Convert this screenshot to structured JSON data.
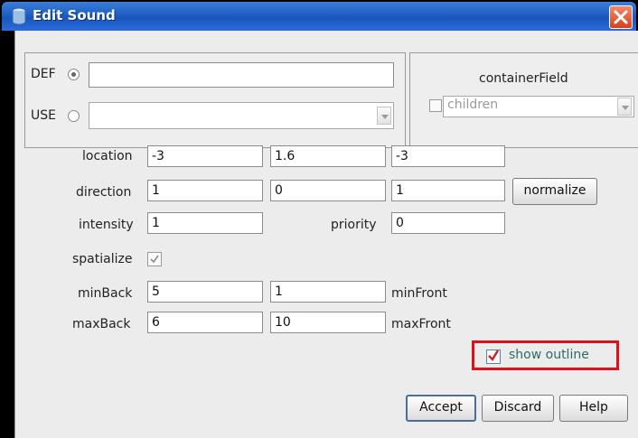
{
  "window": {
    "title": "Edit Sound"
  },
  "def_use": {
    "def_label": "DEF",
    "def_value": "",
    "use_label": "USE",
    "use_value": ""
  },
  "container_field": {
    "title": "containerField",
    "value": "children"
  },
  "fields": {
    "location_label": "location",
    "location": [
      "-3",
      "1.6",
      "-3"
    ],
    "direction_label": "direction",
    "direction": [
      "1",
      "0",
      "1"
    ],
    "normalize_label": "normalize",
    "intensity_label": "intensity",
    "intensity": "1",
    "priority_label": "priority",
    "priority": "0",
    "spatialize_label": "spatialize",
    "spatialize_checked": true,
    "minBack_label": "minBack",
    "minBack": "5",
    "minFront": "1",
    "minFront_label": "minFront",
    "maxBack_label": "maxBack",
    "maxBack": "6",
    "maxFront": "10",
    "maxFront_label": "maxFront"
  },
  "show_outline": {
    "label": "show outline",
    "checked": true
  },
  "buttons": {
    "accept": "Accept",
    "discard": "Discard",
    "help": "Help"
  },
  "colors": {
    "titlebar": "#1f5fc4",
    "highlight": "#e0101a",
    "check": "#cc1f1f"
  }
}
